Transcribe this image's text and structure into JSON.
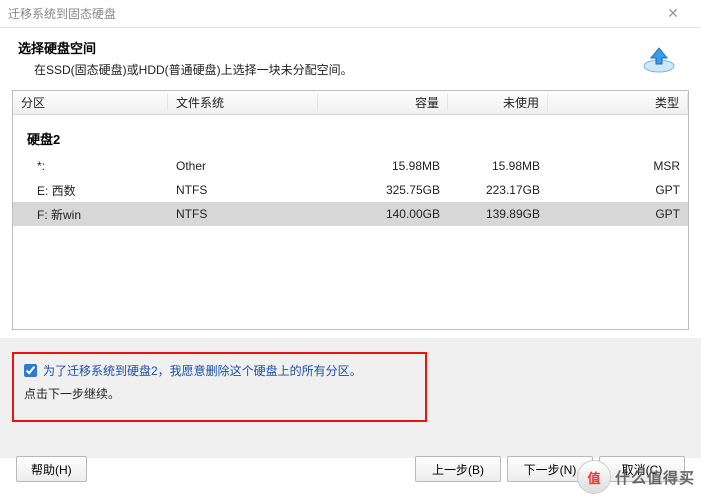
{
  "window": {
    "title": "迁移系统到固态硬盘"
  },
  "header": {
    "heading": "选择硬盘空间",
    "subheading": "在SSD(固态硬盘)或HDD(普通硬盘)上选择一块未分配空间。"
  },
  "table": {
    "columns": [
      "分区",
      "文件系统",
      "容量",
      "未使用",
      "类型"
    ],
    "group_label": "硬盘2",
    "rows": [
      {
        "partition": "*:",
        "fs": "Other",
        "capacity": "15.98MB",
        "unused": "15.98MB",
        "type": "MSR",
        "selected": false
      },
      {
        "partition": "E: 西数",
        "fs": "NTFS",
        "capacity": "325.75GB",
        "unused": "223.17GB",
        "type": "GPT",
        "selected": false
      },
      {
        "partition": "F: 新win",
        "fs": "NTFS",
        "capacity": "140.00GB",
        "unused": "139.89GB",
        "type": "GPT",
        "selected": true
      }
    ]
  },
  "confirm": {
    "checkbox_label": "为了迁移系统到硬盘2，我愿意删除这个硬盘上的所有分区。",
    "continue_hint": "点击下一步继续。",
    "checked": true
  },
  "buttons": {
    "help": "帮助(H)",
    "back": "上一步(B)",
    "next": "下一步(N)",
    "cancel": "取消(C)"
  },
  "watermark": {
    "circle": "值",
    "text": "什么值得买"
  },
  "colors": {
    "highlight_border": "#e11",
    "link_text": "#1b4fa8"
  }
}
